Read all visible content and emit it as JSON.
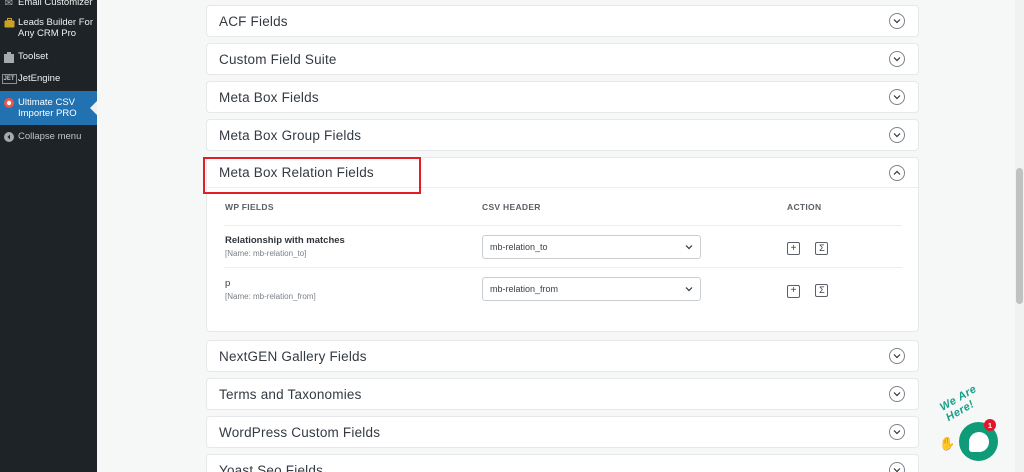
{
  "sidebar": {
    "items": [
      {
        "label": "Email Customizer",
        "icon": "mail-icon"
      },
      {
        "label": "Leads Builder For Any CRM Pro",
        "icon": "briefcase-icon"
      },
      {
        "label": "Toolset",
        "icon": "toolset-icon"
      },
      {
        "label": "JetEngine",
        "icon": "jet-icon",
        "badge": "JET"
      },
      {
        "label": "Ultimate CSV Importer PRO",
        "icon": "csv-importer-icon",
        "active": true
      },
      {
        "label": "Collapse menu",
        "icon": "collapse-icon"
      }
    ]
  },
  "sections": [
    {
      "title": "ACF Fields",
      "expanded": false
    },
    {
      "title": "Custom Field Suite",
      "expanded": false
    },
    {
      "title": "Meta Box Fields",
      "expanded": false
    },
    {
      "title": "Meta Box Group Fields",
      "expanded": false
    },
    {
      "title": "Meta Box Relation Fields",
      "expanded": true
    },
    {
      "title": "NextGEN Gallery Fields",
      "expanded": false
    },
    {
      "title": "Terms and Taxonomies",
      "expanded": false
    },
    {
      "title": "WordPress Custom Fields",
      "expanded": false
    },
    {
      "title": "Yoast Seo Fields",
      "expanded": false
    }
  ],
  "relation_table": {
    "headers": {
      "wp_fields": "WP FIELDS",
      "csv_header": "CSV HEADER",
      "action": "ACTION"
    },
    "rows": [
      {
        "name": "Relationship with matches",
        "sub": "[Name: mb-relation_to]",
        "csv_value": "mb-relation_to"
      },
      {
        "name": "p",
        "sub": "[Name: mb-relation_from]",
        "csv_value": "mb-relation_from"
      }
    ],
    "actions": {
      "add": "+",
      "formula": "Σ"
    }
  },
  "chat": {
    "text": "We Are Here!",
    "badge": "1"
  },
  "colors": {
    "sidebar_bg": "#1d2327",
    "active_bg": "#2271b1",
    "highlight": "#e11d26",
    "chat": "#0f9b78"
  }
}
